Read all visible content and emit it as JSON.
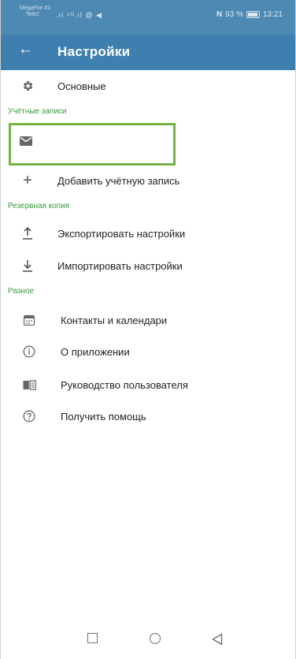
{
  "status": {
    "carrier1": "MegaFon #1",
    "carrier2": "Tele2",
    "signal": ".ıl ⁴ᴳ.ıl @ ◀",
    "nfc": "N",
    "battery": "93 %",
    "time": "13:21"
  },
  "header": {
    "back_icon": "arrow-left-icon",
    "title": "Настройки"
  },
  "items": {
    "general": {
      "label": "Основные",
      "icon": "gear-icon"
    },
    "accounts_section": "Учётные записи",
    "account_entry": {
      "label": "",
      "icon": "envelope-icon"
    },
    "add_account": {
      "label": "Добавить учётную запись",
      "icon": "plus-icon"
    },
    "backup_section": "Резервная копия",
    "export": {
      "label": "Экспортировать настройки",
      "icon": "export-icon"
    },
    "import": {
      "label": "Импортировать настройки",
      "icon": "import-icon"
    },
    "misc_section": "Разное",
    "contacts": {
      "label": "Контакты и календари",
      "icon": "calendar-icon"
    },
    "about": {
      "label": "О приложении",
      "icon": "info-icon"
    },
    "manual": {
      "label": "Руководство пользователя",
      "icon": "book-icon"
    },
    "help": {
      "label": "Получить помощь",
      "icon": "help-icon"
    }
  },
  "colors": {
    "status_bar": "#4e89b4",
    "app_bar": "#3f7fb0",
    "section_text": "#3b9a3b",
    "highlight_border": "#74b245"
  }
}
